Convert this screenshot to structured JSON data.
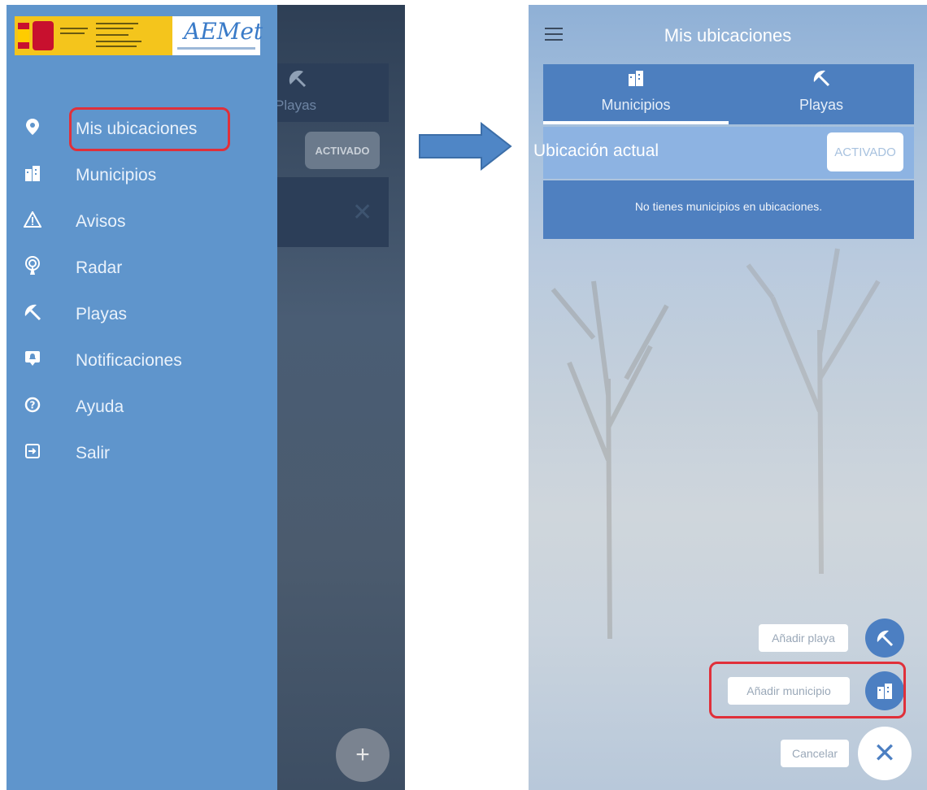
{
  "left_screen": {
    "logo": {
      "brand": "AEMet",
      "icon": "aemet-logo-icon"
    },
    "menu": [
      {
        "label": "Mis ubicaciones",
        "icon": "location-pin-icon"
      },
      {
        "label": "Municipios",
        "icon": "city-buildings-icon"
      },
      {
        "label": "Avisos",
        "icon": "warning-triangle-icon"
      },
      {
        "label": "Radar",
        "icon": "radar-icon"
      },
      {
        "label": "Playas",
        "icon": "beach-umbrella-icon"
      },
      {
        "label": "Notificaciones",
        "icon": "notification-bell-icon"
      },
      {
        "label": "Ayuda",
        "icon": "help-icon"
      },
      {
        "label": "Salir",
        "icon": "exit-icon"
      }
    ],
    "behind": {
      "tab_label": "Playas",
      "activado": "ACTIVADO",
      "fab": "+"
    }
  },
  "right_screen": {
    "title": "Mis ubicaciones",
    "tabs": [
      {
        "label": "Municipios",
        "icon": "city-buildings-icon"
      },
      {
        "label": "Playas",
        "icon": "beach-umbrella-icon"
      }
    ],
    "current_location": {
      "label": "Ubicación actual",
      "button": "ACTIVADO"
    },
    "empty_message": "No tienes municipios en ubicaciones.",
    "fab_menu": {
      "add_beach": "Añadir playa",
      "add_municipality": "Añadir municipio",
      "cancel": "Cancelar",
      "close_symbol": "✕"
    }
  },
  "colors": {
    "drawer": "#5f95cc",
    "tab_bar": "#4d7fbf",
    "highlight": "#e0303a",
    "arrow": "#4f86c6"
  }
}
